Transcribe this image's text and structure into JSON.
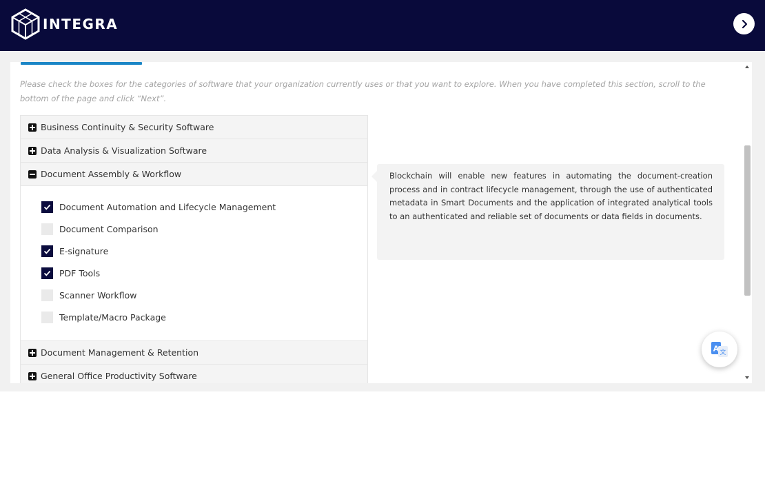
{
  "header": {
    "brand": "INTEGRA",
    "logo_icon": "cube-logo-icon",
    "next_icon": "chevron-right-icon",
    "background_color": "#090a3b"
  },
  "instruction": "Please check the boxes for the categories of software that your organization currently uses or that you want to explore. When you have completed this section, scroll to the bottom of the page and click “Next”.",
  "categories": [
    {
      "label": "Business Continuity & Security Software",
      "expanded": false
    },
    {
      "label": "Data Analysis & Visualization Software",
      "expanded": false
    },
    {
      "label": "Document Assembly & Workflow",
      "expanded": true,
      "options": [
        {
          "label": "Document Automation and Lifecycle Management",
          "checked": true
        },
        {
          "label": "Document Comparison",
          "checked": false
        },
        {
          "label": "E-signature",
          "checked": true
        },
        {
          "label": "PDF Tools",
          "checked": true
        },
        {
          "label": "Scanner Workflow",
          "checked": false
        },
        {
          "label": "Template/Macro Package",
          "checked": false
        }
      ]
    },
    {
      "label": "Document Management & Retention",
      "expanded": false
    },
    {
      "label": "General Office Productivity Software",
      "expanded": false
    }
  ],
  "info_box": {
    "text": "Blockchain will enable new features in automating the document-creation process and in contract lifecycle management, through the use of authenticated metadata in Smart Documents and the application of integrated analytical tools to an authenticated and reliable set of documents or data fields in documents."
  },
  "translate_button": {
    "icon": "translate-icon"
  },
  "colors": {
    "accent": "#1b86c6",
    "checkbox_checked": "#0b0c3e",
    "checkbox_unchecked": "#eaeaea"
  }
}
